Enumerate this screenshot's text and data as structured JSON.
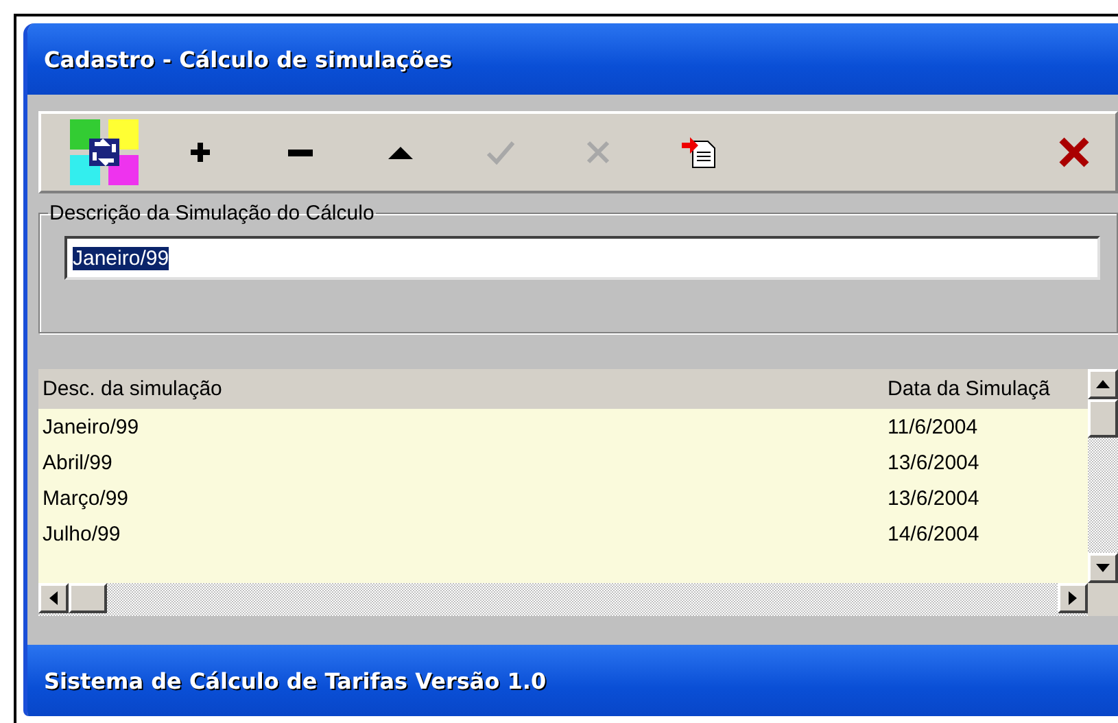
{
  "window": {
    "title": "Cadastro - Cálculo de simulações"
  },
  "toolbar": [
    {
      "kind": "app",
      "disabled": false
    },
    {
      "kind": "add",
      "disabled": false
    },
    {
      "kind": "remove",
      "disabled": false
    },
    {
      "kind": "up",
      "disabled": false
    },
    {
      "kind": "confirm",
      "disabled": true
    },
    {
      "kind": "cancel",
      "disabled": true
    },
    {
      "kind": "export",
      "disabled": false
    },
    {
      "kind": "close",
      "disabled": false
    }
  ],
  "description_group": {
    "label": "Descrição da Simulação do Cálculo",
    "value": "Janeiro/99",
    "value_selected": true
  },
  "table": {
    "columns": [
      "Desc. da simulação",
      "Data da Simulaçã"
    ],
    "rows": [
      [
        "Janeiro/99",
        "11/6/2004"
      ],
      [
        "Abril/99",
        "13/6/2004"
      ],
      [
        "Março/99",
        "13/6/2004"
      ],
      [
        "Julho/99",
        "14/6/2004"
      ]
    ]
  },
  "status_bar": "Sistema de Cálculo de Tarifas Versão 1.0"
}
